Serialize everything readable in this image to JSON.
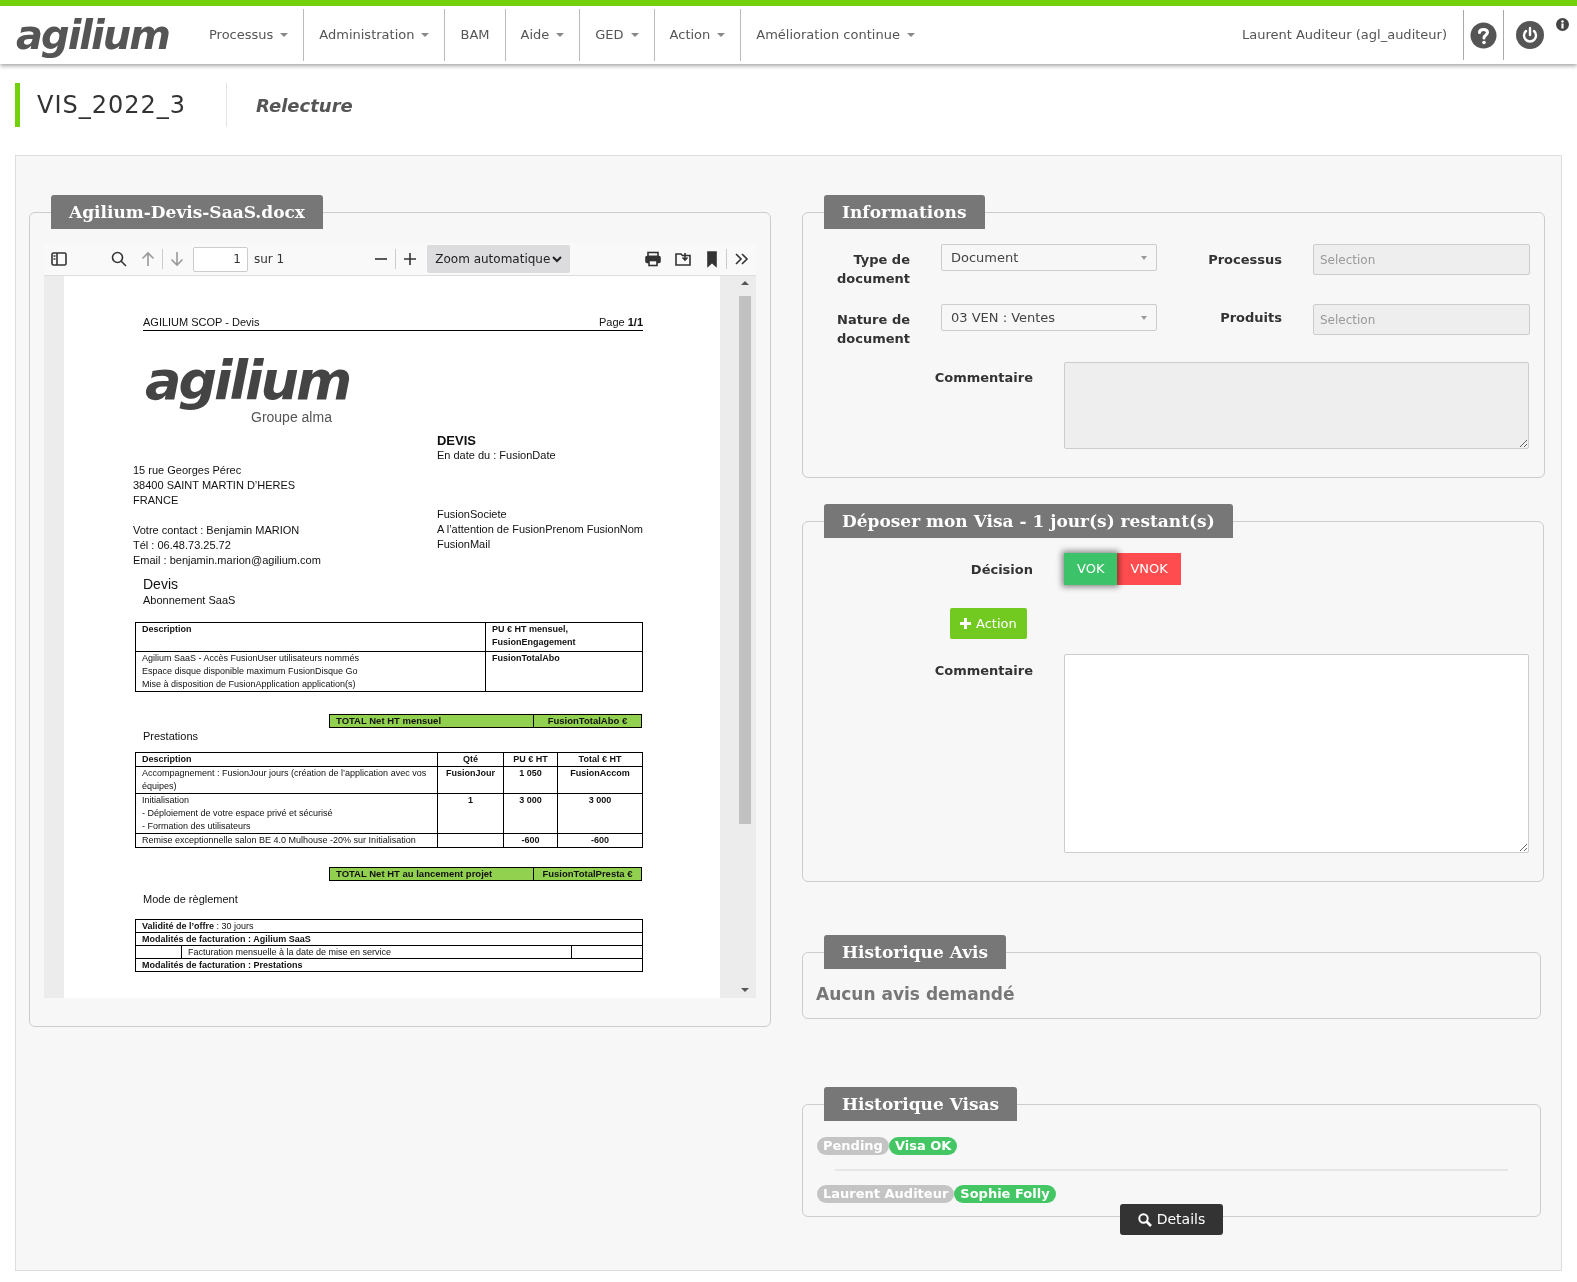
{
  "header": {
    "logo": "agilium",
    "nav": [
      {
        "label": "Processus",
        "dropdown": true
      },
      {
        "label": "Administration",
        "dropdown": true
      },
      {
        "label": "BAM",
        "dropdown": false
      },
      {
        "label": "Aide",
        "dropdown": true
      },
      {
        "label": "GED",
        "dropdown": true
      },
      {
        "label": "Action",
        "dropdown": true
      },
      {
        "label": "Amélioration continue",
        "dropdown": true
      }
    ],
    "user": "Laurent Auditeur (agl_auditeur)"
  },
  "page": {
    "code": "VIS_2022_3",
    "step": "Relecture"
  },
  "document_panel": {
    "title": "Agilium-Devis-SaaS.docx",
    "viewer": {
      "page_value": "1",
      "page_total": "sur 1",
      "zoom": "Zoom automatique"
    },
    "document": {
      "header_left": "AGILIUM SCOP - Devis",
      "header_right": "Page **1/1**",
      "logo": "agilium",
      "logo_subtitle": "Groupe alma",
      "title": "DEVIS",
      "date": "En date du : FusionDate",
      "address": [
        "15 rue Georges Pérec",
        "38400 SAINT MARTIN D’HERES",
        "FRANCE"
      ],
      "contact": [
        "Votre contact : Benjamin MARION",
        "Tél : 06.48.73.25.72",
        "Email : benjamin.marion@agilium.com"
      ],
      "recipient": [
        "FusionSociete",
        "A l’attention de FusionPrenom FusionNom",
        "FusionMail"
      ],
      "section_title": "Devis",
      "subscription": {
        "title": "Abonnement SaaS",
        "columns": [
          "Description",
          "PU € HT mensuel, FusionEngagement"
        ],
        "rows": [
          {
            "cells": [
              "Agilium SaaS - Accès FusionUser utilisateurs nommés\nEspace disque disponible maximum FusionDisque Go\nMise à disposition de FusionApplication application(s)",
              "FusionTotalAbo"
            ]
          }
        ],
        "total": [
          "TOTAL Net HT mensuel",
          "FusionTotalAbo €"
        ]
      },
      "services": {
        "title": "Prestations",
        "columns": [
          "Description",
          "Qté",
          "PU € HT",
          "Total € HT"
        ],
        "rows": [
          {
            "cells": [
              "Accompagnement : FusionJour jours (création de l’application avec vos équipes)",
              "FusionJour",
              "1 050",
              "FusionAccom"
            ]
          },
          {
            "cells": [
              "Initialisation\n - Déploiement de votre espace privé et sécurisé\n - Formation des utilisateurs",
              "1",
              "3 000",
              "3 000"
            ]
          },
          {
            "cells": [
              "Remise exceptionnelle salon BE 4.0 Mulhouse -20% sur Initialisation",
              "",
              "-600",
              "-600"
            ]
          }
        ],
        "total": [
          "TOTAL Net HT au lancement projet",
          "FusionTotalPresta €"
        ]
      },
      "payment": {
        "title": "Mode de règlement",
        "rows": [
          {
            "kind": "field",
            "text": "**Validité de l’offre** : 30 jours"
          },
          {
            "kind": "heading",
            "text": "Modalités de facturation : Agilium SaaS"
          },
          {
            "kind": "indented",
            "text": "Facturation mensuelle à la date de mise en service"
          },
          {
            "kind": "heading",
            "text": "Modalités de facturation : Prestations"
          }
        ]
      }
    }
  },
  "informations": {
    "title": "Informations",
    "fields": [
      {
        "label": "Type de document",
        "kind": "select",
        "value": "Document"
      },
      {
        "label": "Processus",
        "kind": "input",
        "placeholder": "Selection"
      },
      {
        "label": "Nature de document",
        "kind": "select",
        "value": "03 VEN : Ventes"
      },
      {
        "label": "Produits",
        "kind": "input",
        "placeholder": "Selection"
      }
    ],
    "comment_label": "Commentaire"
  },
  "visa": {
    "title": "Déposer mon Visa - 1 jour(s) restant(s)",
    "decision_label": "Décision",
    "options": [
      {
        "label": "VOK",
        "color": "#3cc36a",
        "selected": true
      },
      {
        "label": "VNOK",
        "color": "#ff4d4f",
        "selected": false
      }
    ],
    "action_button": "Action",
    "comment_label": "Commentaire"
  },
  "historique_avis": {
    "title": "Historique Avis",
    "empty_text": "Aucun avis demandé"
  },
  "historique_visas": {
    "title": "Historique Visas",
    "rows": [
      {
        "badges": [
          {
            "label": "Pending",
            "color": "#c4c4c4"
          },
          {
            "label": "Visa OK",
            "color": "#45c665"
          }
        ]
      },
      {
        "badges": [
          {
            "label": "Laurent Auditeur",
            "color": "#c4c4c4"
          },
          {
            "label": "Sophie Folly",
            "color": "#45c665"
          }
        ]
      }
    ],
    "details_button": "Details"
  }
}
